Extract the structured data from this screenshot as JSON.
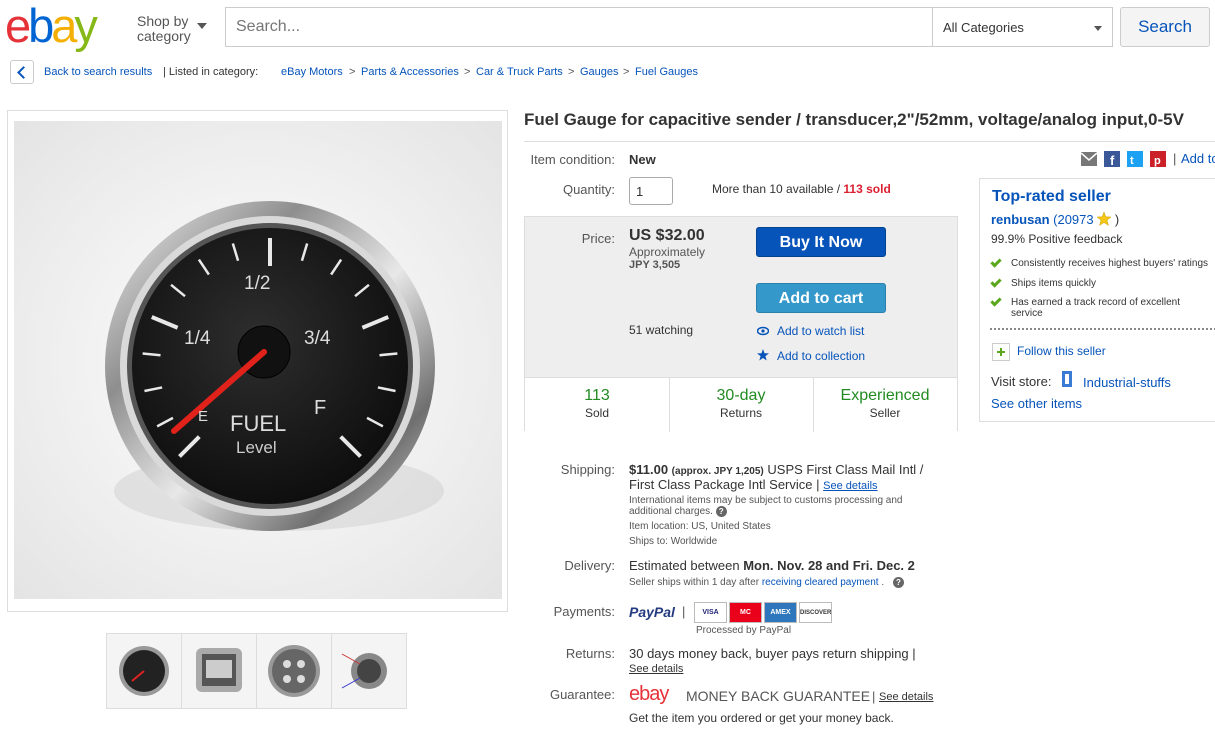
{
  "header": {
    "logo_letters": [
      "e",
      "b",
      "a",
      "y"
    ],
    "logo_colors": [
      "#e53238",
      "#0064d2",
      "#f5af02",
      "#86b817"
    ],
    "shop_by_line1": "Shop by",
    "shop_by_line2": "category",
    "search_placeholder": "Search...",
    "category_selected": "All Categories",
    "search_button": "Search"
  },
  "breadcrumb": {
    "back": "Back to search results",
    "listed": "| Listed in category:",
    "items": [
      "eBay Motors",
      "Parts & Accessories",
      "Car & Truck Parts",
      "Gauges",
      "Fuel Gauges"
    ]
  },
  "gauge": {
    "labels": [
      "1/4",
      "1/2",
      "3/4",
      "F",
      "E"
    ],
    "line1": "FUEL",
    "line2": "Level"
  },
  "title": "Fuel Gauge for capacitive sender / transducer,2\"/52mm, voltage/analog input,0-5V",
  "condition": {
    "label": "Item condition:",
    "value": "New"
  },
  "quantity": {
    "label": "Quantity:",
    "value": "1",
    "available": "More than 10 available / ",
    "sold": "113 sold"
  },
  "share": {
    "add_to": "Add to"
  },
  "price": {
    "label": "Price:",
    "value": "US $32.00",
    "approx": "Approximately",
    "jpy": "JPY 3,505",
    "buy_now": "Buy It Now",
    "add_cart": "Add to cart",
    "watching": "51 watching",
    "watch_list": "Add to watch list",
    "collection": "Add to collection"
  },
  "stats": [
    {
      "big": "113",
      "small": "Sold"
    },
    {
      "big": "30-day",
      "small": "Returns"
    },
    {
      "big": "Experienced",
      "small": "Seller"
    }
  ],
  "seller": {
    "heading": "Top-rated seller",
    "name": "renbusan",
    "score": "(20973",
    "score_close": ")",
    "feedback": "99.9% Positive feedback",
    "points": [
      "Consistently receives highest buyers' ratings",
      "Ships items quickly",
      "Has earned a track record of excellent service"
    ],
    "follow": "Follow this seller",
    "visit_label": "Visit store:",
    "store": "Industrial-stuffs",
    "see_other": "See other items"
  },
  "shipping": {
    "label": "Shipping:",
    "price": "$11.00",
    "approx": "(approx. JPY 1,205)",
    "service1": "USPS First Class Mail Intl /",
    "service2": "First Class Package Intl Service |",
    "see_details": "See details",
    "intl_note1": "International items may be subject to customs processing and",
    "intl_note2": "additional charges.",
    "location": "Item location:  US, United States",
    "ships_to": "Ships to:  Worldwide"
  },
  "delivery": {
    "label": "Delivery:",
    "estimated": "Estimated between ",
    "dates": "Mon. Nov. 28 and Fri. Dec. 2",
    "note": "Seller ships within 1 day after ",
    "note_link": "receiving cleared payment",
    "note_end": " ."
  },
  "payments": {
    "label": "Payments:",
    "paypal": "PayPal",
    "cards": [
      "VISA",
      "MC",
      "AMEX",
      "DISCOVER"
    ],
    "processed": "Processed by PayPal"
  },
  "returns": {
    "label": "Returns:",
    "text": "30 days money back, buyer pays return shipping |",
    "see_details": "See details"
  },
  "guarantee": {
    "label": "Guarantee:",
    "ebay": "ebay",
    "mbg": "MONEY BACK GUARANTEE",
    "see_details": "See details",
    "note": "Get the item you ordered or get your money back."
  }
}
